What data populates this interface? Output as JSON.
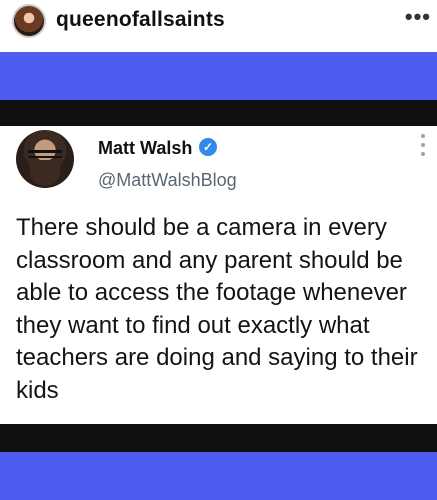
{
  "instagram": {
    "username": "queenofallsaints",
    "more_icon": "•••"
  },
  "tweet": {
    "display_name": "Matt Walsh",
    "verified_icon": "✓",
    "handle": "@MattWalshBlog",
    "text": "There should be a camera in every classroom and any parent should be able to access the footage whenever they want to find out exactly what teachers are doing and saying to their kids"
  },
  "colors": {
    "band_blue": "#4f5cf0",
    "band_black": "#101010",
    "verified_blue": "#2f8ae8"
  }
}
